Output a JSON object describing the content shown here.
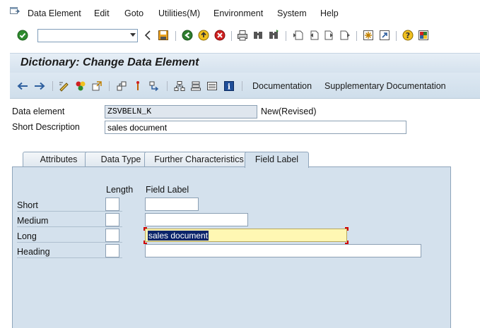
{
  "menu": {
    "items": [
      "Data Element",
      "Edit",
      "Goto",
      "Utilities(M)",
      "Environment",
      "System",
      "Help"
    ]
  },
  "toolbar": {
    "command_value": "",
    "icons": [
      "enter-icon",
      "back-icon",
      "save-icon",
      "back-green-icon",
      "exit-icon",
      "cancel-icon",
      "print-icon",
      "find-icon",
      "find-next-icon",
      "first-page-icon",
      "previous-page-icon",
      "next-page-icon",
      "last-page-icon",
      "create-session-icon",
      "shortcut-icon",
      "help-icon",
      "customize-icon"
    ]
  },
  "title": "Dictionary: Change Data Element",
  "app_toolbar": {
    "documentation": "Documentation",
    "supplementary_documentation": "Supplementary Documentation"
  },
  "header": {
    "data_element_label": "Data element",
    "data_element_value": "ZSVBELN_K",
    "status": "New(Revised)",
    "short_description_label": "Short Description",
    "short_description_value": "sales document"
  },
  "tabs": [
    {
      "label": "Attributes",
      "active": false
    },
    {
      "label": "Data Type",
      "active": false
    },
    {
      "label": "Further Characteristics",
      "active": false
    },
    {
      "label": "Field Label",
      "active": true
    }
  ],
  "field_label_panel": {
    "length_header": "Length",
    "field_label_header": "Field Label",
    "rows": [
      {
        "label": "Short",
        "length": "",
        "value": ""
      },
      {
        "label": "Medium",
        "length": "",
        "value": ""
      },
      {
        "label": "Long",
        "length": "",
        "value": "sales document"
      },
      {
        "label": "Heading",
        "length": "",
        "value": ""
      }
    ]
  },
  "colors": {
    "panel_bg": "#d4e1ed",
    "focus_bg": "#fff7b3",
    "selection": "#0a246a"
  }
}
